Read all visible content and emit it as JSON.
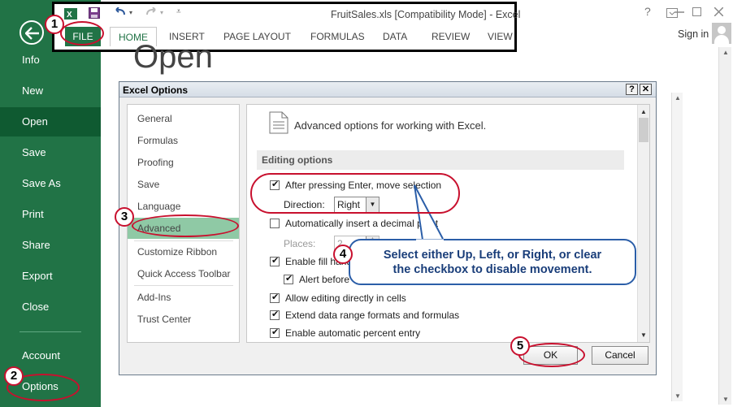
{
  "window": {
    "doc_title": "FruitSales.xls  [Compatibility Mode] - Excel",
    "help": "?",
    "signin": "Sign in"
  },
  "ribbon": {
    "tabs": [
      "FILE",
      "HOME",
      "INSERT",
      "PAGE LAYOUT",
      "FORMULAS",
      "DATA",
      "REVIEW",
      "VIEW"
    ]
  },
  "backstage": {
    "items": [
      "Info",
      "New",
      "Open",
      "Save",
      "Save As",
      "Print",
      "Share",
      "Export",
      "Close",
      "Account",
      "Options"
    ],
    "active": "Open",
    "page_title": "Open"
  },
  "dialog": {
    "title": "Excel Options",
    "help_btn": "?",
    "close_btn": "✕",
    "categories": [
      "General",
      "Formulas",
      "Proofing",
      "Save",
      "Language",
      "Advanced",
      "Customize Ribbon",
      "Quick Access Toolbar",
      "Add-Ins",
      "Trust Center"
    ],
    "selected_category": "Advanced",
    "heading": "Advanced options for working with Excel.",
    "section": "Editing options",
    "options": [
      {
        "label": "After pressing Enter, move selection",
        "checked": true
      },
      {
        "label": "Automatically insert a decimal point",
        "checked": false
      },
      {
        "label": "Enable fill handle and cell drag-and-drop",
        "checked": true
      },
      {
        "label": "Alert before overwriting cells",
        "checked": true
      },
      {
        "label": "Allow editing directly in cells",
        "checked": true
      },
      {
        "label": "Extend data range formats and formulas",
        "checked": true
      },
      {
        "label": "Enable automatic percent entry",
        "checked": true
      }
    ],
    "direction_label": "Direction:",
    "direction_value": "Right",
    "places_label": "Places:",
    "places_value": "2",
    "ok": "OK",
    "cancel": "Cancel"
  },
  "annotations": {
    "steps": [
      "1",
      "2",
      "3",
      "4",
      "5"
    ],
    "callout_line1": "Select either Up, Left, or Right, or clear",
    "callout_line2": "the checkbox to disable movement."
  },
  "colors": {
    "excel_green": "#217346",
    "active_green": "#0f5a31",
    "selected_category": "#8fc9a5",
    "annotation_red": "#c8102e",
    "callout_text": "#1a3e7a"
  }
}
